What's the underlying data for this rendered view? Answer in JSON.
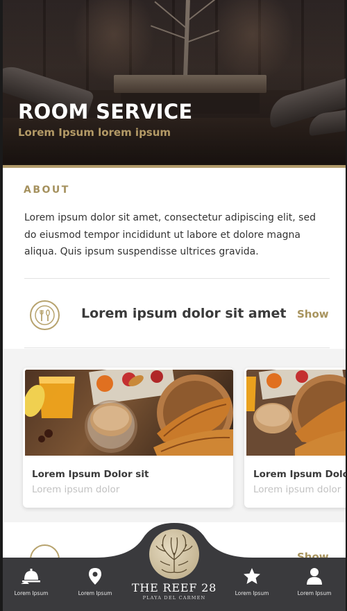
{
  "header": {
    "title": "ROOM SERVICE",
    "subtitle": "Lorem Ipsum lorem ipsum"
  },
  "about": {
    "heading": "ABOUT",
    "text": "Lorem ipsum dolor sit amet, consectetur adipiscing elit, sed do eiusmod tempor incididunt ut labore et dolore magna aliqua. Quis ipsum suspendisse ultrices gravida."
  },
  "section": {
    "icon": "cutlery-icon",
    "title": "Lorem ipsum dolor sit amet",
    "show_label": "Show"
  },
  "cards": [
    {
      "title": "Lorem Ipsum Dolor sit",
      "subtitle": "Lorem ipsum dolor",
      "image": "breakfast-croissant-coffee-photo"
    },
    {
      "title": "Lorem Ipsum Dolor",
      "subtitle": "Lorem ipsum dolor",
      "image": "breakfast-croissant-coffee-photo"
    }
  ],
  "section2": {
    "icon": "cutlery-icon",
    "show_label": "Show"
  },
  "nav": {
    "items": [
      {
        "icon": "room-service-bell-icon",
        "label": "Lorem Ipsum"
      },
      {
        "icon": "map-pin-icon",
        "label": "Lorem Ipsum"
      },
      {
        "icon": "star-icon",
        "label": "Lorem Ipsum"
      },
      {
        "icon": "user-icon",
        "label": "Lorem Ipsum"
      }
    ],
    "brand": {
      "name": "THE REEF 28",
      "location": "PLAYA DEL CARMEN",
      "logo_icon": "tree-logo-icon"
    }
  },
  "colors": {
    "accent_gold": "#b09a6a",
    "nav_bg": "#3a3a3d",
    "text_dark": "#3a3a3a"
  }
}
